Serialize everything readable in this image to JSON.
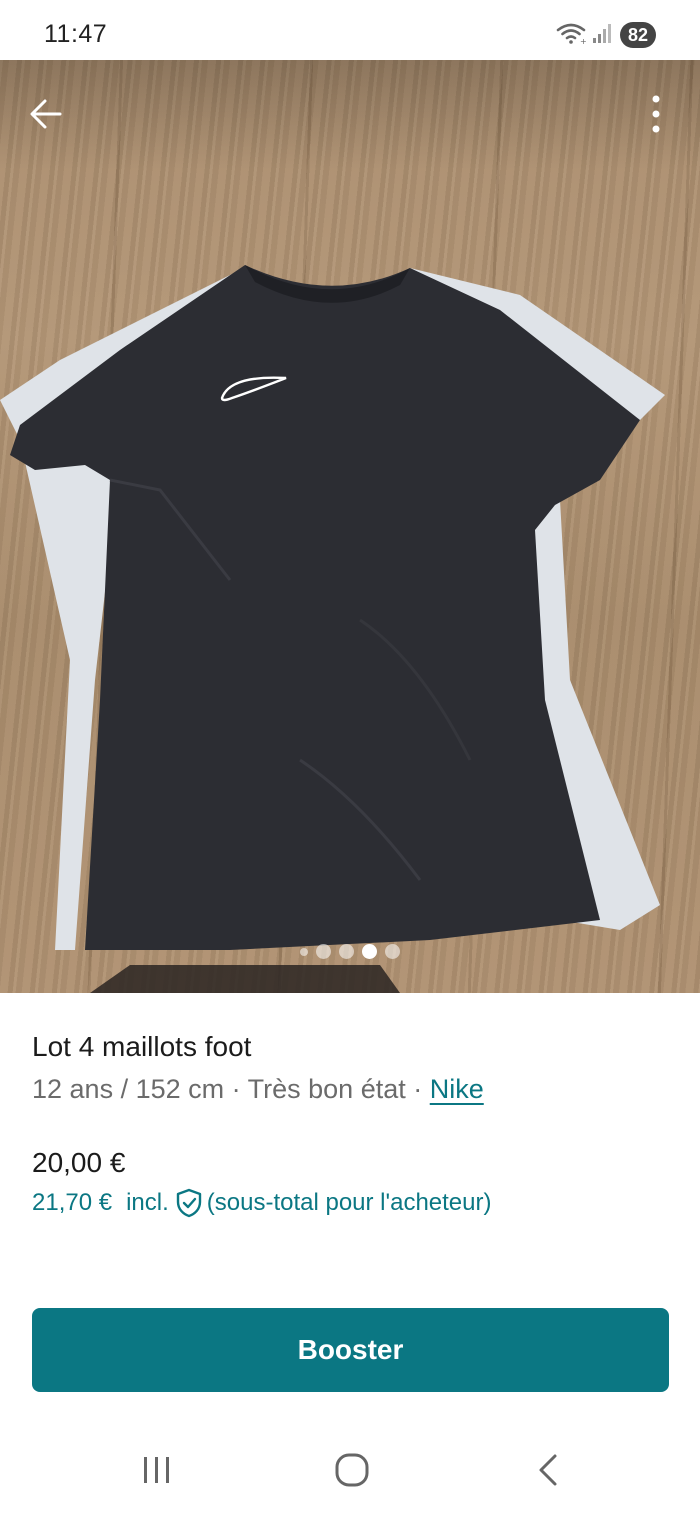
{
  "status_bar": {
    "time": "11:47",
    "battery": "82",
    "icons": [
      "wifi-icon",
      "signal-icon",
      "battery-icon"
    ]
  },
  "photo": {
    "image_count": 5,
    "active_index": 3,
    "icons": {
      "back": "arrow-left-icon",
      "more": "more-vertical-icon"
    }
  },
  "item": {
    "title": "Lot 4 maillots foot",
    "size": "12 ans / 152 cm",
    "separator": " · ",
    "condition": "Très bon état",
    "brand": "Nike",
    "price": "20,00 €",
    "price_incl": "21,70 €",
    "incl_label": "incl.",
    "buyer_subtotal": "(sous-total pour l'acheteur)"
  },
  "actions": {
    "booster_label": "Booster"
  },
  "nav_bar": {
    "icons": [
      "recents-icon",
      "home-icon",
      "back-icon"
    ]
  },
  "colors": {
    "accent": "#0b7783",
    "text": "#1b1b1b",
    "muted": "#6b6b6b"
  }
}
